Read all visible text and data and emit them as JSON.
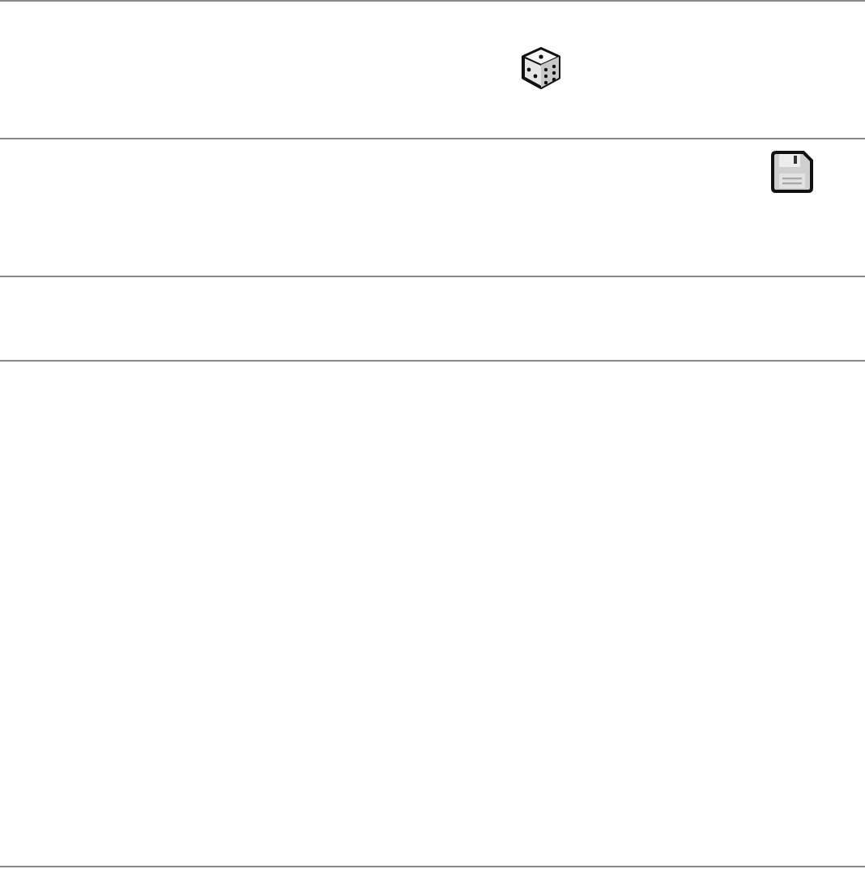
{
  "rows": [
    {
      "kind": "dice"
    },
    {
      "kind": "save"
    },
    {
      "kind": "empty"
    },
    {
      "kind": "empty"
    }
  ]
}
